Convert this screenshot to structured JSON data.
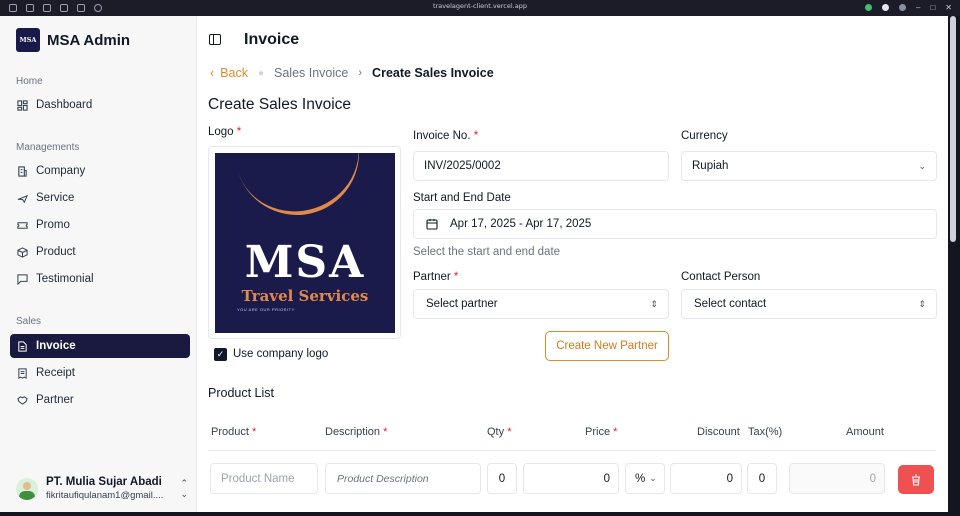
{
  "browser": {
    "url": "travelagent-client.vercel.app"
  },
  "sidebar": {
    "brand": {
      "logo_text": "MSA",
      "title": "MSA Admin"
    },
    "home_label": "Home",
    "home_items": [
      {
        "label": "Dashboard",
        "icon": "dashboard-icon"
      }
    ],
    "managements_label": "Managements",
    "managements_items": [
      {
        "label": "Company",
        "icon": "building-icon"
      },
      {
        "label": "Service",
        "icon": "plane-icon"
      },
      {
        "label": "Promo",
        "icon": "ticket-icon"
      },
      {
        "label": "Product",
        "icon": "box-icon"
      },
      {
        "label": "Testimonial",
        "icon": "message-icon"
      }
    ],
    "sales_label": "Sales",
    "sales_items": [
      {
        "label": "Invoice",
        "icon": "file-icon",
        "active": true
      },
      {
        "label": "Receipt",
        "icon": "receipt-icon"
      },
      {
        "label": "Partner",
        "icon": "handshake-icon"
      }
    ],
    "user": {
      "name": "PT. Mulia Sujar Abadi",
      "email": "fikritaufiqulanam1@gmail...."
    }
  },
  "header": {
    "title": "Invoice"
  },
  "breadcrumb": {
    "back": "Back",
    "parent": "Sales Invoice",
    "current": "Create Sales Invoice"
  },
  "form": {
    "title": "Create Sales Invoice",
    "logo_label": "Logo",
    "logo": {
      "main": "MSA",
      "sub": "Travel Services",
      "tagline": "YOU ARE OUR PRIORITY"
    },
    "use_company_logo": {
      "label": "Use company logo",
      "checked": true
    },
    "invoice_no_label": "Invoice No.",
    "invoice_no_value": "INV/2025/0002",
    "currency_label": "Currency",
    "currency_value": "Rupiah",
    "date_label": "Start and End Date",
    "date_value": "Apr 17, 2025 - Apr 17, 2025",
    "date_helper": "Select the start and end date",
    "partner_label": "Partner",
    "partner_value": "Select partner",
    "contact_label": "Contact Person",
    "contact_value": "Select contact",
    "create_partner_button": "Create New Partner"
  },
  "product_list": {
    "title": "Product List",
    "columns": {
      "product": "Product",
      "description": "Description",
      "qty": "Qty",
      "price": "Price",
      "discount": "Discount",
      "tax": "Tax(%)",
      "amount": "Amount"
    },
    "row": {
      "product_placeholder": "Product Name",
      "description_placeholder": "Product Description",
      "qty": "0",
      "price": "0",
      "discount_type": "%",
      "discount": "0",
      "tax": "0",
      "amount": "0"
    }
  },
  "colors": {
    "accent": "#e08a2e",
    "sidebar_active": "#1a1a40",
    "danger": "#ef5050"
  }
}
